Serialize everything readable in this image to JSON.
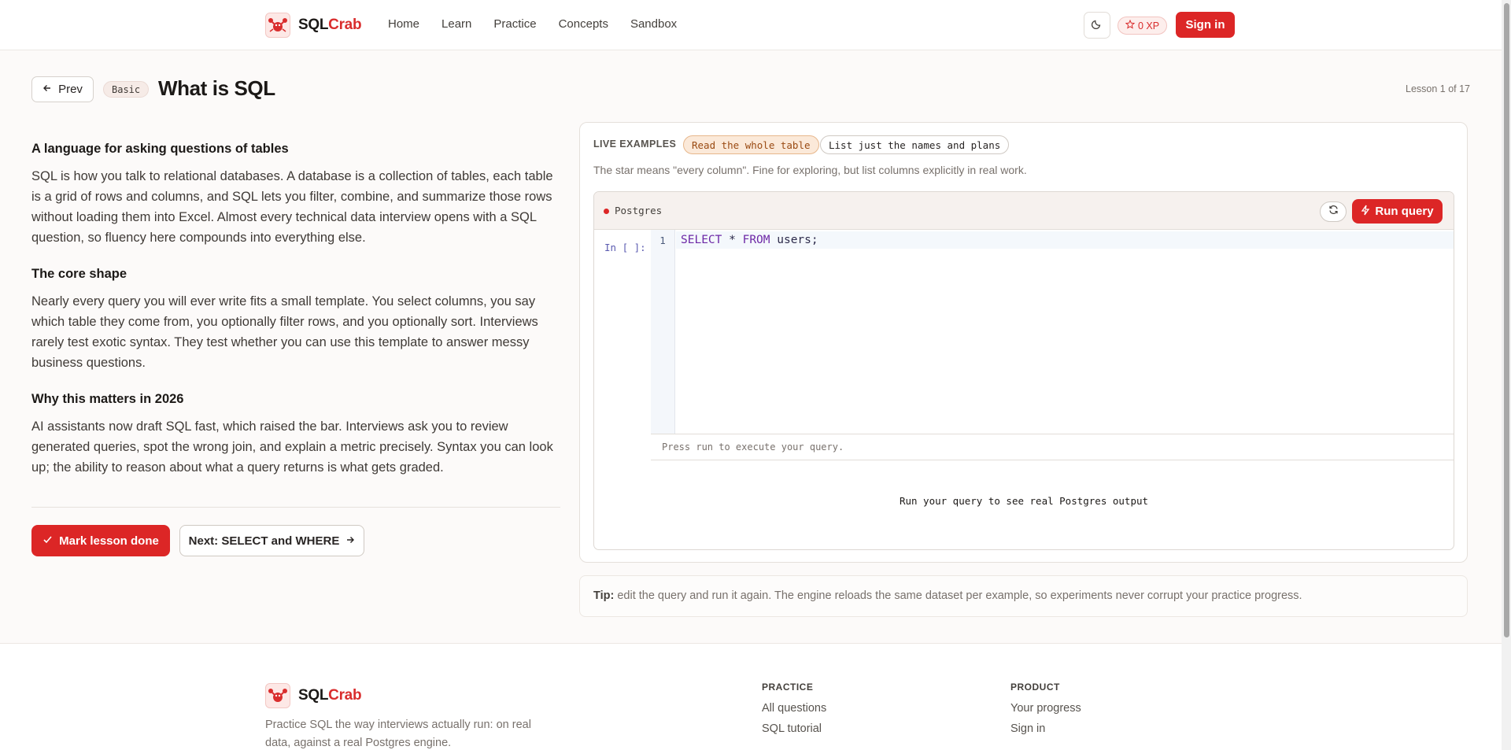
{
  "header": {
    "brand_prefix": "SQL",
    "brand_suffix": "Crab",
    "nav": [
      "Home",
      "Learn",
      "Practice",
      "Concepts",
      "Sandbox"
    ],
    "xp": "0 XP",
    "signin": "Sign in"
  },
  "lesson": {
    "prev": "Prev",
    "level": "Basic",
    "title": "What is SQL",
    "count": "Lesson 1 of 17"
  },
  "article": {
    "sections": [
      {
        "heading": "A language for asking questions of tables",
        "body": "SQL is how you talk to relational databases. A database is a collection of tables, each table is a grid of rows and columns, and SQL lets you filter, combine, and summarize those rows without loading them into Excel. Almost every technical data interview opens with a SQL question, so fluency here compounds into everything else."
      },
      {
        "heading": "The core shape",
        "body": "Nearly every query you will ever write fits a small template. You select columns, you say which table they come from, you optionally filter rows, and you optionally sort. Interviews rarely test exotic syntax. They test whether you can use this template to answer messy business questions."
      },
      {
        "heading": "Why this matters in 2026",
        "body": "AI assistants now draft SQL fast, which raised the bar. Interviews ask you to review generated queries, spot the wrong join, and explain a metric precisely. Syntax you can look up; the ability to reason about what a query returns is what gets graded."
      }
    ],
    "done_button": "Mark lesson done",
    "next_button": "Next: SELECT and WHERE"
  },
  "live": {
    "label": "LIVE EXAMPLES",
    "examples": [
      "Read the whole table",
      "List just the names and plans"
    ],
    "active_example": "Read the whole table",
    "description": "The star means \"every column\". Fine for exploring, but list columns explicitly in real work.",
    "engine": "Postgres",
    "run_button": "Run query",
    "in_prompt": "In [ ]:",
    "line_number": "1",
    "code": {
      "kw_select": "SELECT",
      "star": " * ",
      "kw_from": "FROM",
      "rest": " users;"
    },
    "hint": "Press run to execute your query.",
    "output_message": "Run your query to see real Postgres output"
  },
  "tip": {
    "label": "Tip:",
    "text": " edit the query and run it again. The engine reloads the same dataset per example, so experiments never corrupt your practice progress."
  },
  "footer": {
    "description": "Practice SQL the way interviews actually run: on real data, against a real Postgres engine.",
    "practice_heading": "PRACTICE",
    "practice_links": [
      "All questions",
      "SQL tutorial"
    ],
    "product_heading": "PRODUCT",
    "product_links": [
      "Your progress",
      "Sign in"
    ]
  },
  "colors": {
    "accent": "#dc2626",
    "active_chip_bg": "#fbe9d9",
    "keyword": "#6d28a6"
  },
  "icons": [
    "crab-logo-icon",
    "moon-icon",
    "star-icon",
    "arrow-left-icon",
    "check-icon",
    "arrow-right-icon",
    "refresh-icon",
    "bolt-icon"
  ]
}
